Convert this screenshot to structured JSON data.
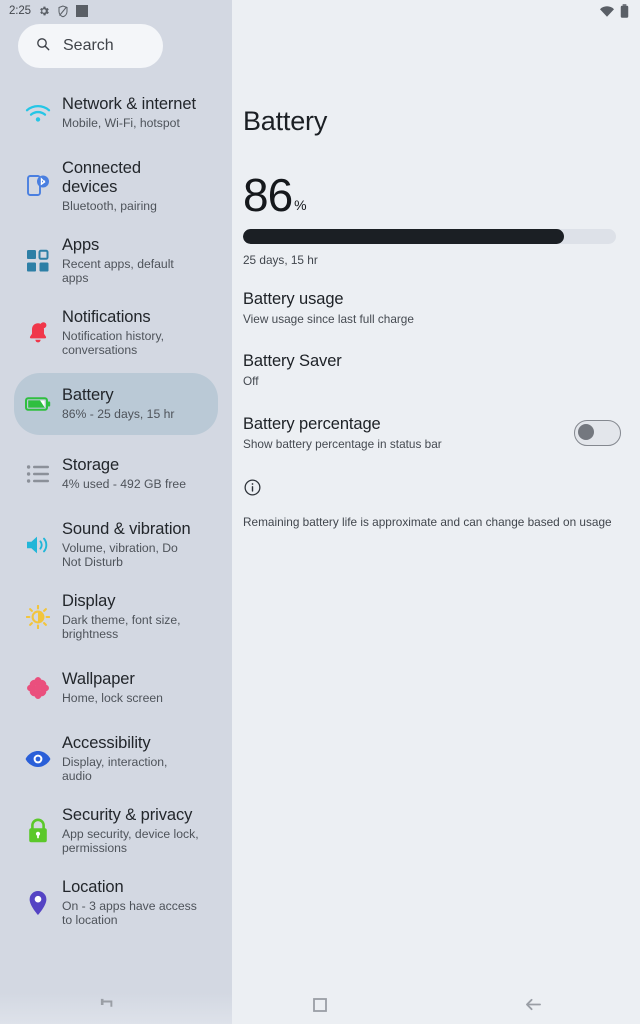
{
  "status_bar": {
    "time": "2:25",
    "left_icons": [
      "gear-icon",
      "shield-slash-icon",
      "square-icon"
    ],
    "right_icons": [
      "wifi-icon",
      "battery-icon"
    ]
  },
  "sidebar": {
    "search": {
      "placeholder": "Search",
      "icon": "search-icon"
    },
    "items": [
      {
        "title": "Network & internet",
        "subtitle": "Mobile, Wi-Fi, hotspot",
        "icon": "wifi-icon",
        "color": "#25c6e6",
        "selected": false
      },
      {
        "title": "Connected devices",
        "subtitle": "Bluetooth, pairing",
        "icon": "connected-devices-icon",
        "color": "#4a7fe0",
        "selected": false
      },
      {
        "title": "Apps",
        "subtitle": "Recent apps, default apps",
        "icon": "apps-grid-icon",
        "color": "#2d7fa6",
        "selected": false
      },
      {
        "title": "Notifications",
        "subtitle": "Notification history, conversations",
        "icon": "bell-icon",
        "color": "#f0374a",
        "selected": false
      },
      {
        "title": "Battery",
        "subtitle": "86% - 25 days, 15 hr",
        "icon": "battery-icon",
        "color": "#2fbf3f",
        "selected": true
      },
      {
        "title": "Storage",
        "subtitle": "4% used - 492 GB free",
        "icon": "storage-list-icon",
        "color": "#8b9099",
        "selected": false
      },
      {
        "title": "Sound & vibration",
        "subtitle": "Volume, vibration, Do Not Disturb",
        "icon": "speaker-icon",
        "color": "#22b6d8",
        "selected": false
      },
      {
        "title": "Display",
        "subtitle": "Dark theme, font size, brightness",
        "icon": "brightness-icon",
        "color": "#f2c53d",
        "selected": false
      },
      {
        "title": "Wallpaper",
        "subtitle": "Home, lock screen",
        "icon": "flower-icon",
        "color": "#ea4f7d",
        "selected": false
      },
      {
        "title": "Accessibility",
        "subtitle": "Display, interaction, audio",
        "icon": "eye-icon",
        "color": "#2a5fd8",
        "selected": false
      },
      {
        "title": "Security & privacy",
        "subtitle": "App security, device lock, permissions",
        "icon": "lock-icon",
        "color": "#5bc82a",
        "selected": false
      },
      {
        "title": "Location",
        "subtitle": "On - 3 apps have access to location",
        "icon": "location-pin-icon",
        "color": "#5544c4",
        "selected": false
      }
    ]
  },
  "main": {
    "title": "Battery",
    "percentage": "86",
    "percent_symbol": "%",
    "battery_level": 86,
    "remaining": "25 days, 15 hr",
    "preferences": [
      {
        "title": "Battery usage",
        "subtitle": "View usage since last full charge",
        "has_switch": false
      },
      {
        "title": "Battery Saver",
        "subtitle": "Off",
        "has_switch": false
      },
      {
        "title": "Battery percentage",
        "subtitle": "Show battery percentage in status bar",
        "has_switch": true,
        "switch_on": false
      }
    ],
    "footer_icon": "info-icon",
    "footer_note": "Remaining battery life is approximate and can change based on usage"
  },
  "navbar": {
    "buttons": [
      {
        "name": "recents-button",
        "icon": "recents-icon"
      },
      {
        "name": "home-button",
        "icon": "home-square-icon"
      },
      {
        "name": "back-button",
        "icon": "back-arrow-icon"
      }
    ]
  },
  "colors": {
    "sidebar_bg": "#d3d8e2",
    "main_bg": "#eceff3",
    "selected_bg": "#bac9d6",
    "bar_fill": "#1b1f24",
    "bar_track": "#dde1e8"
  }
}
